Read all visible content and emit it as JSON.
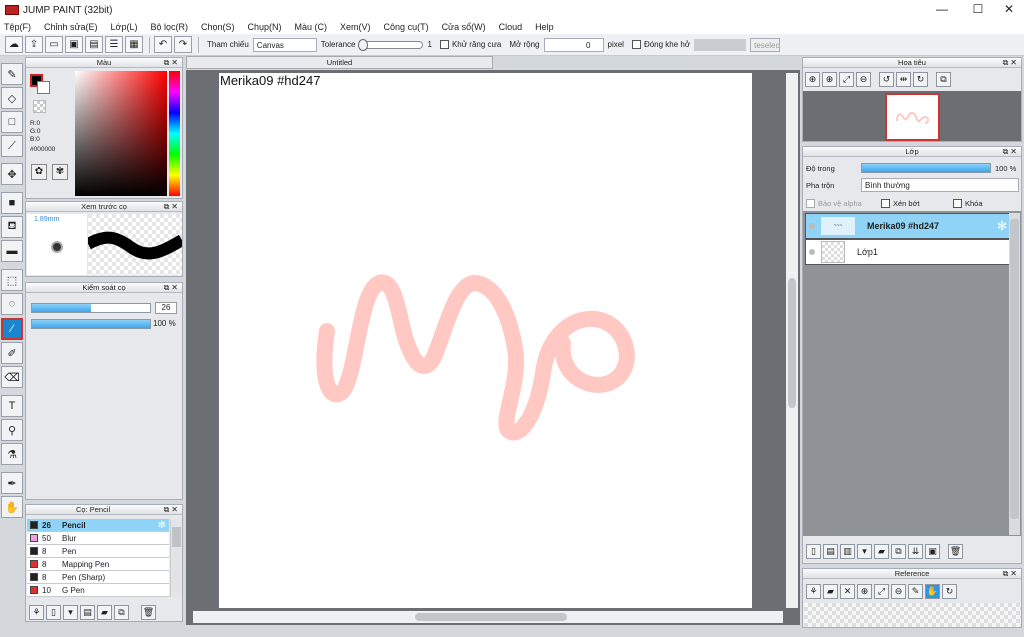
{
  "window": {
    "title": "JUMP PAINT (32bit)",
    "minimize": "—",
    "maximize": "☐",
    "close": "✕"
  },
  "menu": [
    "Tệp(F)",
    "Chỉnh sửa(E)",
    "Lớp(L)",
    "Bộ lọc(R)",
    "Chọn(S)",
    "Chụp(N)",
    "Màu (C)",
    "Xem(V)",
    "Công cụ(T)",
    "Cửa sổ(W)",
    "Cloud",
    "Help"
  ],
  "toolbar": {
    "ref_label": "Tham chiếu",
    "ref_value": "Canvas",
    "tolerance_label": "Tolerance",
    "tolerance_value": "1",
    "antialias_label": "Khử răng cưa",
    "expand_label": "Mở rộng",
    "expand_value": "0",
    "expand_unit": "pixel",
    "gap_label": "Đóng khe hở",
    "tesselec": "teselec"
  },
  "doc_tab": "Untitled",
  "canvas": {
    "text": "Merika09  #hd247",
    "stroke_color": "#ffc8c3"
  },
  "color_panel": {
    "title": "Màu",
    "r": "R:0",
    "g": "G:0",
    "b": "B:0",
    "hex": "#000000"
  },
  "preview_panel": {
    "title": "Xem trước cọ",
    "size": "1.89mm"
  },
  "brush_control": {
    "title": "Kiểm soát cọ",
    "size_value": "26",
    "size_fill": 0.5,
    "opacity_value": "100 %",
    "opacity_fill": 1.0
  },
  "tool_marker": "1",
  "brush_panel": {
    "title": "Cọ: Pencil",
    "items": [
      {
        "num": "26",
        "name": "Pencil",
        "color": "#222222",
        "selected": true
      },
      {
        "num": "50",
        "name": "Blur",
        "color": "#f0a0e0",
        "selected": false
      },
      {
        "num": "8",
        "name": "Pen",
        "color": "#222222",
        "selected": false
      },
      {
        "num": "8",
        "name": "Mapping Pen",
        "color": "#e23030",
        "selected": false
      },
      {
        "num": "8",
        "name": "Pen (Sharp)",
        "color": "#222222",
        "selected": false
      },
      {
        "num": "10",
        "name": "G Pen",
        "color": "#e23030",
        "selected": false
      }
    ]
  },
  "navigator_panel": {
    "title": "Hoa tiêu"
  },
  "layer_panel": {
    "title": "Lớp",
    "opacity_label": "Độ trong",
    "opacity_value": "100 %",
    "opacity_fill": 1.0,
    "blend_label": "Pha trộn",
    "blend_value": "Bình thường",
    "protect_alpha": "Bảo vệ alpha",
    "clip": "Xén bớt",
    "lock": "Khóa",
    "layers": [
      {
        "name": "Merika09  #hd247",
        "selected": true
      },
      {
        "name": "Lớp1",
        "selected": false
      }
    ]
  },
  "reference_panel": {
    "title": "Reference"
  }
}
